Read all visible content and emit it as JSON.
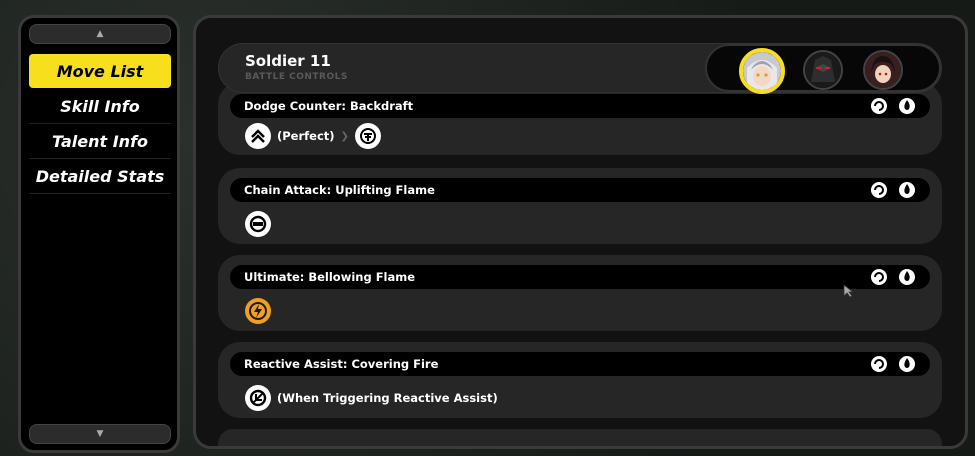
{
  "nav": {
    "items": [
      {
        "label": "Move List",
        "active": true
      },
      {
        "label": "Skill Info",
        "active": false
      },
      {
        "label": "Talent Info",
        "active": false
      },
      {
        "label": "Detailed Stats",
        "active": false
      }
    ],
    "scroll_up_icon": "chevron-up-icon",
    "scroll_down_icon": "chevron-down-icon"
  },
  "header": {
    "title": "Soldier 11",
    "subtitle": "BATTLE CONTROLS"
  },
  "avatars": [
    {
      "name": "character-1",
      "selected": true,
      "accent": "#f7df1e"
    },
    {
      "name": "character-2",
      "selected": false
    },
    {
      "name": "character-3",
      "selected": false
    }
  ],
  "moves": [
    {
      "title": "Dodge Counter: Backdraft",
      "inputs": [
        "dodge-icon",
        "(Perfect)",
        "basic-attack-icon"
      ]
    },
    {
      "title": "Chain Attack: Uplifting Flame",
      "inputs": [
        "qte-icon"
      ]
    },
    {
      "title": "Ultimate: Bellowing Flame",
      "inputs": [
        "ultimate-icon"
      ]
    },
    {
      "title": "Reactive Assist: Covering Fire",
      "inputs": [
        "assist-icon",
        "(When Triggering Reactive Assist)"
      ]
    }
  ],
  "body_texts": {
    "perfect": "(Perfect)",
    "reactive": "(When Triggering Reactive Assist)"
  },
  "colors": {
    "accent": "#f7df1e",
    "card_bg": "#262626",
    "ultimate_orange": "#f0a020"
  }
}
